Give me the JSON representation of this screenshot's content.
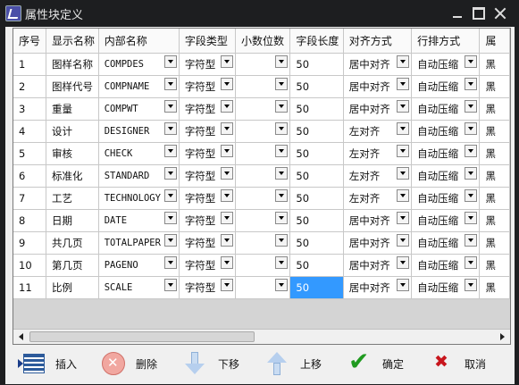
{
  "window": {
    "title": "属性块定义"
  },
  "table": {
    "columns": [
      "序号",
      "显示名称",
      "内部名称",
      "字段类型",
      "小数位数",
      "字段长度",
      "对齐方式",
      "行排方式",
      "属"
    ],
    "rows": [
      {
        "no": "1",
        "display": "图样名称",
        "internal": "COMPDES",
        "type": "字符型",
        "decimals": "",
        "length": "50",
        "align": "居中对齐",
        "layout": "自动压缩",
        "attr": "黑"
      },
      {
        "no": "2",
        "display": "图样代号",
        "internal": "COMPNAME",
        "type": "字符型",
        "decimals": "",
        "length": "50",
        "align": "居中对齐",
        "layout": "自动压缩",
        "attr": "黑"
      },
      {
        "no": "3",
        "display": "重量",
        "internal": "COMPWT",
        "type": "字符型",
        "decimals": "",
        "length": "50",
        "align": "居中对齐",
        "layout": "自动压缩",
        "attr": "黑"
      },
      {
        "no": "4",
        "display": "设计",
        "internal": "DESIGNER",
        "type": "字符型",
        "decimals": "",
        "length": "50",
        "align": "左对齐",
        "layout": "自动压缩",
        "attr": "黑"
      },
      {
        "no": "5",
        "display": "审核",
        "internal": "CHECK",
        "type": "字符型",
        "decimals": "",
        "length": "50",
        "align": "左对齐",
        "layout": "自动压缩",
        "attr": "黑"
      },
      {
        "no": "6",
        "display": "标准化",
        "internal": "STANDARD",
        "type": "字符型",
        "decimals": "",
        "length": "50",
        "align": "左对齐",
        "layout": "自动压缩",
        "attr": "黑"
      },
      {
        "no": "7",
        "display": "工艺",
        "internal": "TECHNOLOGY",
        "type": "字符型",
        "decimals": "",
        "length": "50",
        "align": "左对齐",
        "layout": "自动压缩",
        "attr": "黑"
      },
      {
        "no": "8",
        "display": "日期",
        "internal": "DATE",
        "type": "字符型",
        "decimals": "",
        "length": "50",
        "align": "居中对齐",
        "layout": "自动压缩",
        "attr": "黑"
      },
      {
        "no": "9",
        "display": "共几页",
        "internal": "TOTALPAPER",
        "type": "字符型",
        "decimals": "",
        "length": "50",
        "align": "居中对齐",
        "layout": "自动压缩",
        "attr": "黑"
      },
      {
        "no": "10",
        "display": "第几页",
        "internal": "PAGENO",
        "type": "字符型",
        "decimals": "",
        "length": "50",
        "align": "居中对齐",
        "layout": "自动压缩",
        "attr": "黑"
      },
      {
        "no": "11",
        "display": "比例",
        "internal": "SCALE",
        "type": "字符型",
        "decimals": "",
        "length": "50",
        "align": "居中对齐",
        "layout": "自动压缩",
        "attr": "黑",
        "selected": true
      }
    ]
  },
  "buttons": {
    "insert": "插入",
    "delete": "删除",
    "move_down": "下移",
    "move_up": "上移",
    "ok": "确定",
    "cancel": "取消"
  },
  "colors": {
    "selection": "#3399ff",
    "titlebar": "#1d1e20",
    "ok_icon": "#1f9a1f",
    "cancel_icon": "#c8161d"
  },
  "icons": {
    "insert": "insert-row-icon",
    "delete": "delete-icon",
    "move_down": "arrow-down-icon",
    "move_up": "arrow-up-icon",
    "ok": "checkmark-icon",
    "cancel": "cross-icon"
  }
}
